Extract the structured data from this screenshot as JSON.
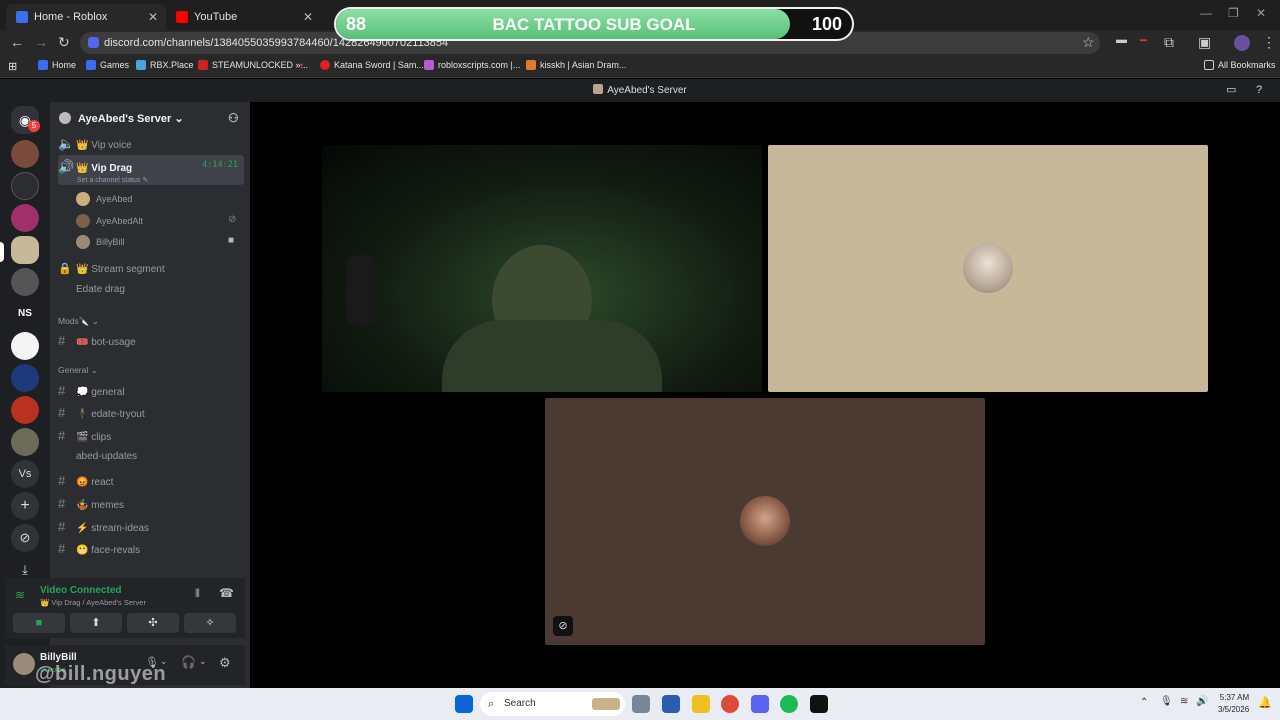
{
  "browser": {
    "tabs": [
      {
        "title": "Home - Roblox",
        "close": "✕"
      },
      {
        "title": "YouTube",
        "close": "✕"
      }
    ],
    "url": "discord.com/channels/1384055035993784460/1428264900702113854",
    "bookmarks": [
      "Home",
      "Games",
      "RBX.Place",
      "STEAMUNLOCKED »...",
      "Katana Sword | Sam...",
      "robloxscripts.com |...",
      "kisskh | Asian Dram..."
    ],
    "all_bookmarks": "All Bookmarks"
  },
  "goal": {
    "current": "88",
    "title": "BAC TATTOO SUB GOAL",
    "target": "100",
    "progress": 0.88
  },
  "discord": {
    "window_title": "AyeAbed's Server",
    "notification_count": "5",
    "guild_letters": {
      "ns": "NS",
      "vs": "Vs"
    },
    "server_name": "AyeAbed's Server",
    "voice_channels": [
      {
        "name": "👑 Vip voice"
      },
      {
        "name": "👑 Vip Drag",
        "time": "4:14:21",
        "status": "Set a channel status"
      }
    ],
    "members": [
      "AyeAbed",
      "AyeAbedAlt",
      "BillyBill"
    ],
    "more_channels": [
      "👑 Stream segment",
      "Edate drag"
    ],
    "categories": {
      "mods": "Mods🔪",
      "general": "General"
    },
    "mod_channels": [
      "🎟️ bot-usage"
    ],
    "text_channels": [
      "💭 general",
      "🕴️ edate-tryout",
      "🎬 clips",
      "abed-updates",
      "😡 react",
      "🤹 memes",
      "⚡ stream-ideas",
      "😬 face-revals"
    ],
    "voice_status": {
      "title": "Video Connected",
      "detail": "👑 Vip Drag / AyeAbed's Server"
    },
    "user": {
      "name": "BillyBill",
      "status": "In voice"
    },
    "watermark": "@bill.nguyen"
  },
  "taskbar": {
    "search_placeholder": "Search",
    "time": "5:37 AM",
    "date": "3/5/2026"
  }
}
